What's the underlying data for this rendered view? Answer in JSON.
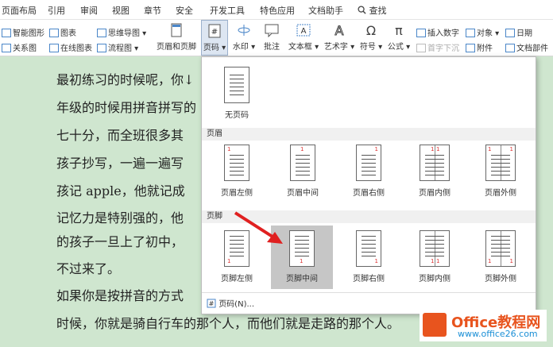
{
  "tabs": [
    "页面布局",
    "引用",
    "审阅",
    "视图",
    "章节",
    "安全",
    "开发工具",
    "特色应用",
    "文档助手",
    "查找"
  ],
  "ribbon": {
    "smartshape": "智能图形",
    "chart": "图表",
    "mindmap": "思维导图",
    "relation": "关系图",
    "onlinechart": "在线图表",
    "flowchart": "流程图",
    "header_footer": "页眉和页脚",
    "page_number": "页码",
    "watermark": "水印",
    "comment": "批注",
    "textbox": "文本框",
    "wordart": "艺术字",
    "symbol": "符号",
    "formula": "公式",
    "insert_number": "插入数字",
    "object": "对象",
    "date": "日期",
    "initial_drop": "首字下沉",
    "attachment": "附件",
    "doc_parts": "文档部件"
  },
  "document": {
    "lines": [
      "最初练习的时候呢，你↓",
      "年级的时候用拼音拼写的",
      "七十分，而全班很多其",
      "孩子抄写，一遍一遍写",
      "孩记 apple，他就记成",
      "记忆力是特别强的，他",
      "的孩子一旦上了初中，",
      "不过来了。",
      "如果你是按拼音的方式",
      "时候，你就是骑自行车的那个人，而他们就是走路的那个人。"
    ]
  },
  "panel": {
    "none": "无页码",
    "header_section": "页眉",
    "footer_section": "页脚",
    "header_options": [
      "页眉左侧",
      "页眉中间",
      "页眉右侧",
      "页眉内侧",
      "页眉外侧"
    ],
    "footer_options": [
      "页脚左侧",
      "页脚中间",
      "页脚右侧",
      "页脚内侧",
      "页脚外侧"
    ],
    "bottom_link": "页码(N)..."
  },
  "watermark": {
    "brand": "Office教程网",
    "url": "www.office26.com"
  },
  "colors": {
    "doc_bg": "#cfe6cf",
    "arrow": "#e02020",
    "selected": "#c6c6c6"
  }
}
